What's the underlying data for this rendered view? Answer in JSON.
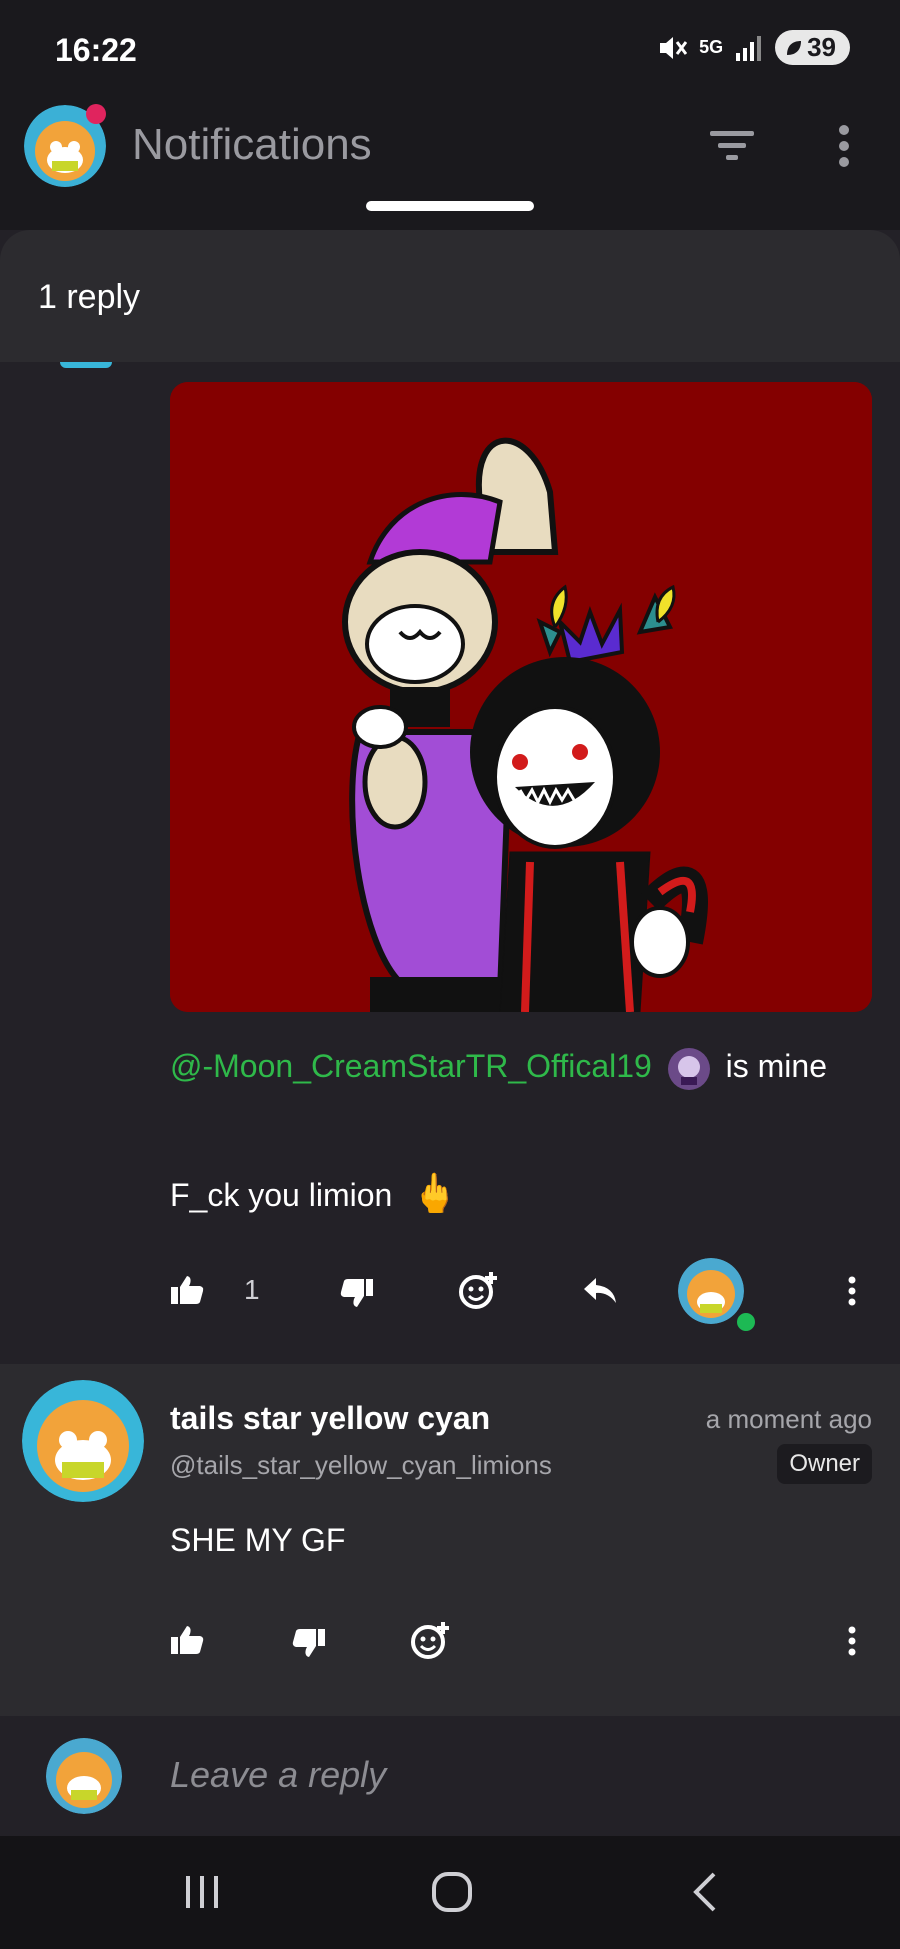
{
  "status": {
    "time": "16:22",
    "network": "5G",
    "battery": "39"
  },
  "header": {
    "title": "Notifications"
  },
  "sheet": {
    "title": "1 reply"
  },
  "post": {
    "mention": "@-Moon_CreamStarTR_Offical19",
    "mention_suffix": " is mine",
    "line2": "F_ck you limion",
    "emoji": "🖕",
    "like_count": "1"
  },
  "reply": {
    "display_name": "tails star yellow cyan",
    "handle": "@tails_star_yellow_cyan_limions",
    "timestamp": "a moment ago",
    "badge": "Owner",
    "text": "SHE MY GF"
  },
  "composer": {
    "placeholder": "Leave a reply"
  },
  "colors": {
    "mention": "#2fb94a",
    "art_background": "#840000",
    "online_dot": "#1db954"
  }
}
